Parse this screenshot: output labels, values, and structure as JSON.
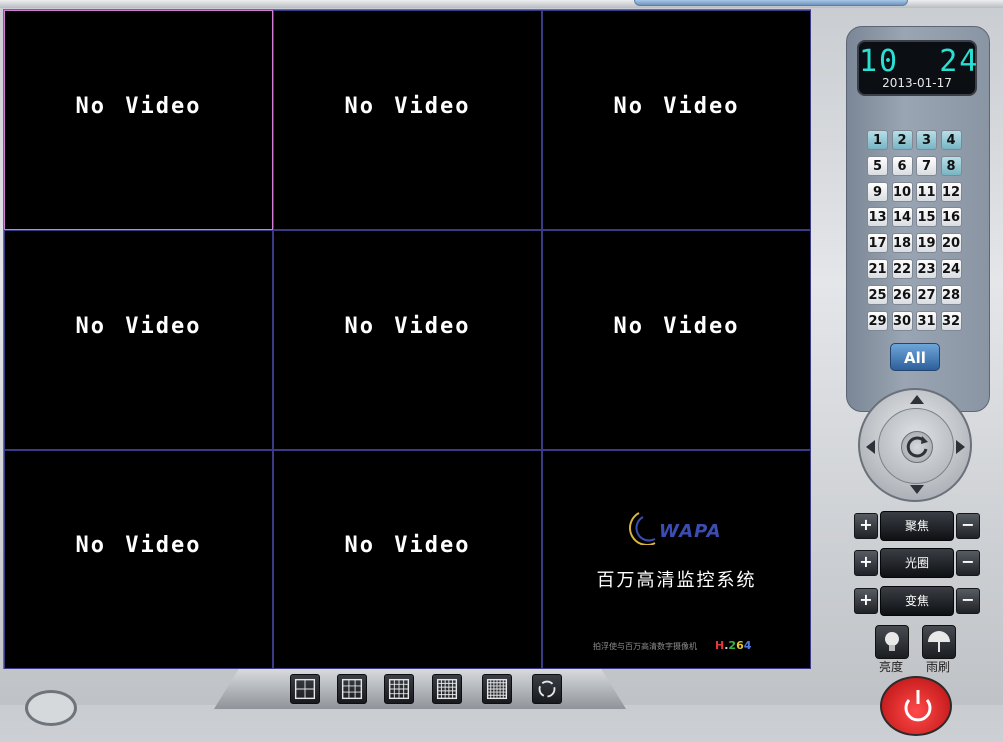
{
  "video_cells": [
    {
      "label": "No Video"
    },
    {
      "label": "No Video"
    },
    {
      "label": "No Video"
    },
    {
      "label": "No Video"
    },
    {
      "label": "No Video"
    },
    {
      "label": "No Video"
    },
    {
      "label": "No Video"
    },
    {
      "label": "No Video"
    }
  ],
  "logo_cell": {
    "brand": "WAPA",
    "system_name": "百万高清监控系统",
    "footer_text": "拍浮使与百万高清数字摄像机",
    "codec_parts": [
      "H",
      ".",
      "2",
      "6",
      "4"
    ]
  },
  "clock": {
    "hour": "10",
    "minute": "24",
    "date": "2013-01-17"
  },
  "channels": [
    "1",
    "2",
    "3",
    "4",
    "5",
    "6",
    "7",
    "8",
    "9",
    "10",
    "11",
    "12",
    "13",
    "14",
    "15",
    "16",
    "17",
    "18",
    "19",
    "20",
    "21",
    "22",
    "23",
    "24",
    "25",
    "26",
    "27",
    "28",
    "29",
    "30",
    "31",
    "32"
  ],
  "active_channels": [
    "1",
    "2",
    "3",
    "4",
    "8"
  ],
  "all_button": "All",
  "ptz_controls": [
    {
      "label": "聚焦",
      "plus": "+",
      "minus": "−"
    },
    {
      "label": "光圈",
      "plus": "+",
      "minus": "−"
    },
    {
      "label": "变焦",
      "plus": "+",
      "minus": "−"
    }
  ],
  "aux": {
    "brightness_label": "亮度",
    "wiper_label": "雨刷"
  },
  "colors": {
    "clock_digits": "#29e0d2",
    "cell_border": "#3b3a86",
    "selected_cell_border": "#d67bd6",
    "all_button": "#2d5f9c",
    "power": "#d41414"
  },
  "bottom_toolbar": [
    "layout-2x2-icon",
    "layout-3x3-icon",
    "layout-4x4-icon",
    "layout-5x5-icon",
    "layout-6x6-icon",
    "cycle-icon"
  ]
}
